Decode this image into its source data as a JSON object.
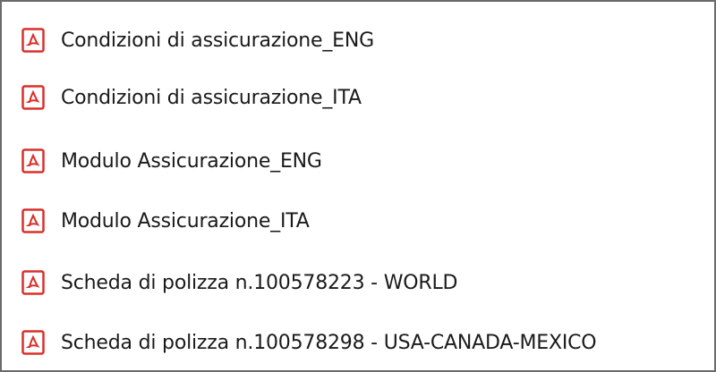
{
  "files": [
    {
      "name": "Condizioni di assicurazione_ENG",
      "icon": "pdf-file-icon"
    },
    {
      "name": "Condizioni di assicurazione_ITA",
      "icon": "pdf-file-icon"
    },
    {
      "name": "Modulo Assicurazione_ENG",
      "icon": "pdf-file-icon"
    },
    {
      "name": "Modulo Assicurazione_ITA",
      "icon": "pdf-file-icon"
    },
    {
      "name": "Scheda di polizza n.100578223 - WORLD",
      "icon": "pdf-file-icon"
    },
    {
      "name": "Scheda di polizza n.100578298 - USA-CANADA-MEXICO",
      "icon": "pdf-file-icon"
    }
  ],
  "colors": {
    "icon_red": "#d9302c",
    "border": "#6b6b6b",
    "text": "#1a1a1a"
  }
}
